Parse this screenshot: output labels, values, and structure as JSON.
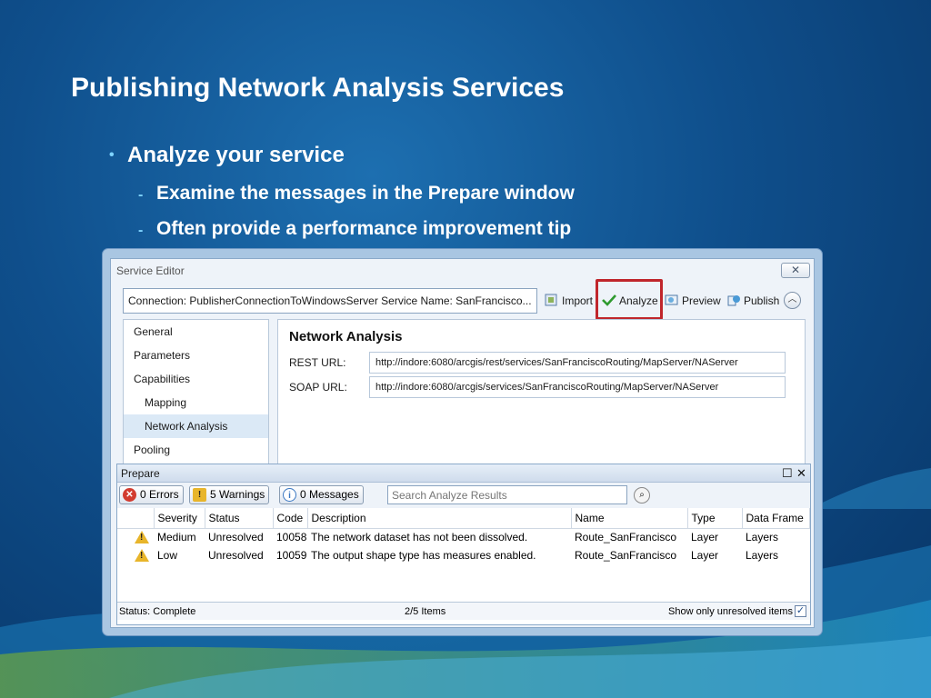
{
  "slide": {
    "title": "Publishing Network Analysis Services",
    "bullet": "Analyze your service",
    "sub_bullets": [
      "Examine the messages in the Prepare window",
      "Often provide a performance improvement tip"
    ],
    "bullet_marker": "•",
    "sub_marker": "-"
  },
  "service_editor": {
    "title": "Service Editor",
    "close_glyph": "✕",
    "connection_text": "Connection: PublisherConnectionToWindowsServer   Service Name: SanFrancisco...",
    "toolbar": {
      "import": "Import",
      "analyze": "Analyze",
      "preview": "Preview",
      "publish": "Publish"
    },
    "nav": [
      "General",
      "Parameters",
      "Capabilities",
      "Mapping",
      "Network Analysis",
      "Pooling"
    ],
    "panel": {
      "heading": "Network Analysis",
      "rest_label": "REST URL:",
      "rest_value": "http://indore:6080/arcgis/rest/services/SanFranciscoRouting/MapServer/NAServer",
      "soap_label": "SOAP URL:",
      "soap_value": "http://indore:6080/arcgis/services/SanFranciscoRouting/MapServer/NAServer"
    }
  },
  "prepare": {
    "title": "Prepare",
    "errors_label": "0 Errors",
    "warnings_label": "5 Warnings",
    "messages_label": "0 Messages",
    "search_placeholder": "Search Analyze Results",
    "columns": [
      "Severity",
      "Status",
      "Code",
      "Description",
      "Name",
      "Type",
      "Data Frame"
    ],
    "rows": [
      {
        "severity": "Medium",
        "status": "Unresolved",
        "code": "10058",
        "description": "The network dataset has not been dissolved.",
        "name": "Route_SanFrancisco",
        "type": "Layer",
        "data_frame": "Layers"
      },
      {
        "severity": "Low",
        "status": "Unresolved",
        "code": "10059",
        "description": "The output shape type has measures enabled.",
        "name": "Route_SanFrancisco",
        "type": "Layer",
        "data_frame": "Layers"
      }
    ],
    "status": "Status: Complete",
    "items": "2/5 Items",
    "show_unresolved": "Show only unresolved items",
    "show_unresolved_checked": true
  },
  "colors": {
    "highlight": "#c0262c",
    "warning": "#e8b52a",
    "error": "#d23b2f",
    "info": "#3b78c2"
  }
}
